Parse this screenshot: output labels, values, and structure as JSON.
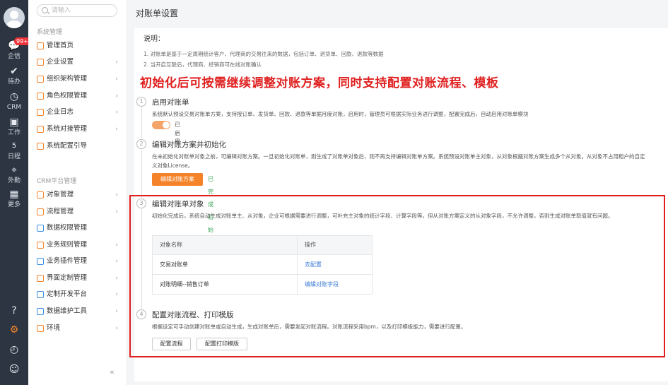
{
  "rail": {
    "badge": "99+",
    "items": [
      {
        "icon": "chat-icon",
        "label": "企信"
      },
      {
        "icon": "check-icon",
        "label": "待办"
      },
      {
        "icon": "clock-icon",
        "label": "CRM"
      },
      {
        "icon": "briefcase-icon",
        "label": "工作"
      },
      {
        "icon": "calendar-icon",
        "label": "日程"
      },
      {
        "icon": "location-icon",
        "label": "外勤"
      },
      {
        "icon": "grid-icon",
        "label": "更多"
      }
    ],
    "calendar_day": "5"
  },
  "nav": {
    "search_placeholder": "请输入",
    "system_section": "系统管理",
    "system_items": [
      {
        "label": "管理首页",
        "chevron": false
      },
      {
        "label": "企业设置",
        "chevron": true
      },
      {
        "label": "组织架构管理",
        "chevron": true
      },
      {
        "label": "角色权限管理",
        "chevron": true
      },
      {
        "label": "企业日志",
        "chevron": true
      },
      {
        "label": "系统对接管理",
        "chevron": true
      },
      {
        "label": "系统配置引导",
        "chevron": false
      }
    ],
    "crm_section": "CRM平台管理",
    "crm_items": [
      {
        "label": "对象管理",
        "chevron": true
      },
      {
        "label": "流程管理",
        "chevron": true
      },
      {
        "label": "数据权限管理",
        "chevron": false
      },
      {
        "label": "业务规则管理",
        "chevron": true
      },
      {
        "label": "业务插件管理",
        "chevron": true
      },
      {
        "label": "界面定制管理",
        "chevron": true
      },
      {
        "label": "定制开发平台",
        "chevron": true
      },
      {
        "label": "数据维护工具",
        "chevron": true
      },
      {
        "label": "环境",
        "chevron": true
      }
    ],
    "collapse_glyph": "«"
  },
  "page": {
    "title": "对账单设置",
    "notes_heading": "说明：",
    "notes": [
      "1. 对账单是基于一定周期统计客户、代理商的交易往来的数据，包括订单、退货单、回款、退款等数据",
      "2. 当开启互联后，代理商、经销商可在线对账确认"
    ],
    "overlay": "初始化后可按需继续调整对账方案，同时支持配置对账流程、模板",
    "steps": [
      {
        "num": "1",
        "title": "启用对账单",
        "desc": "系统默认预设交易对账单方案，支持按订单、发货单、回款、退款等单据月度对账，启用时，管理员可根据实际业务进行调整，配置完成后，自动启用对账单模块",
        "toggle_label": "已启用",
        "toggle_on": true
      },
      {
        "num": "2",
        "title": "编辑对账方案并初始化",
        "desc": "在未初始化对账单对象之前，可编辑对账方案。一旦初始化对账单，则生成了对账单对象后，则不再支持编辑对账单方案。系统预设对账单主对象，从对象根据对账方案生成多个从对象。从对象不占用租户的自定义对象License。",
        "button": "编辑对账方案",
        "status": "已完成初始化"
      },
      {
        "num": "3",
        "title": "编辑对账单对象",
        "desc": "初始化完成后，系统自动生成对账单主、从对象，企业可根据需要进行调整，可补充主对象的统计字段、计算字段等。但从对账方案定义的从对象字段，不允许调整，否则生成对账单取值就有问题。",
        "table": {
          "headers": [
            "对象名称",
            "操作"
          ],
          "rows": [
            [
              "交易对账单",
              "去配置"
            ],
            [
              "对账明细--销售订单",
              "编辑对账字段"
            ]
          ]
        }
      },
      {
        "num": "4",
        "title": "配置对账流程、打印模版",
        "desc": "根据设定可手动创建对账单或自动生成，生成对账单后，需要发起对账流程。对账流程采用bpm，以及打印模板能力，需要进行配置。",
        "buttons": [
          "配置流程",
          "配置打印模版"
        ]
      }
    ]
  },
  "colors": {
    "accent": "#f5832a",
    "link": "#3a7bd5",
    "highlight": "#e02020",
    "success": "#3aa757"
  }
}
